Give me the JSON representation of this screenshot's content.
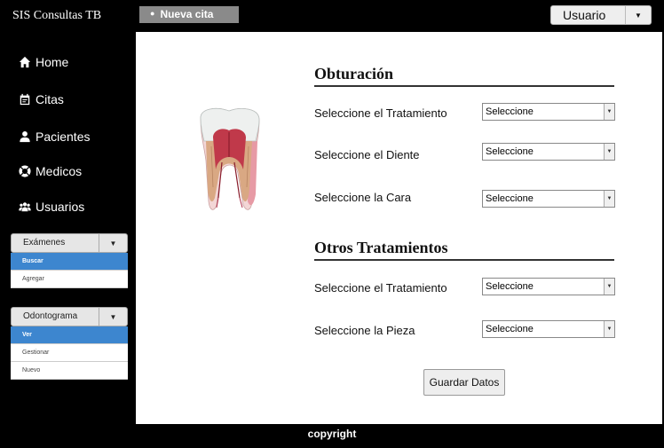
{
  "app": {
    "title": "SIS Consultas TB"
  },
  "topbar": {
    "new_appointment_label": "Nueva cita",
    "user_menu_label": "Usuario"
  },
  "sidebar": {
    "items": [
      {
        "label": "Home",
        "icon": "home-icon"
      },
      {
        "label": "Citas",
        "icon": "calendar-icon"
      },
      {
        "label": "Pacientes",
        "icon": "person-icon"
      },
      {
        "label": "Medicos",
        "icon": "lifebuoy-icon"
      },
      {
        "label": "Usuarios",
        "icon": "users-icon"
      }
    ],
    "examenes": {
      "label": "Exámenes",
      "options": [
        "Buscar",
        "Agregar"
      ],
      "active": "Buscar"
    },
    "odontograma": {
      "label": "Odontograma",
      "options": [
        "Ver",
        "Gestionar",
        "Nuevo"
      ],
      "active": "Ver"
    }
  },
  "main": {
    "obturacion": {
      "title": "Obturación",
      "rows": [
        {
          "label": "Seleccione el Tratamiento",
          "value": "Seleccione"
        },
        {
          "label": "Seleccione el Diente",
          "value": "Seleccione"
        },
        {
          "label": "Seleccione la Cara",
          "value": "Seleccione"
        }
      ]
    },
    "otros": {
      "title": "Otros Tratamientos",
      "rows": [
        {
          "label": "Seleccione el Tratamiento",
          "value": "Seleccione"
        },
        {
          "label": "Seleccione la Pieza",
          "value": "Seleccione"
        }
      ]
    },
    "save_label": "Guardar Datos"
  },
  "footer": {
    "text": "copyright"
  },
  "colors": {
    "active_option": "#3d86cf",
    "background": "#000000",
    "panel": "#ffffff"
  }
}
